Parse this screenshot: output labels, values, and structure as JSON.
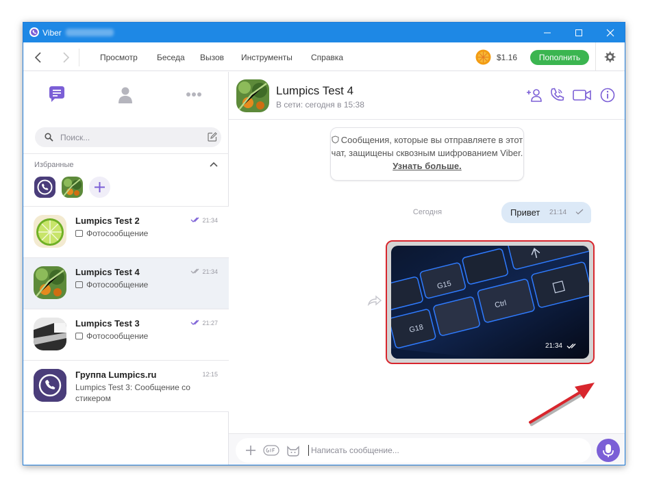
{
  "window": {
    "title": "Viber"
  },
  "menu": {
    "items": [
      "Просмотр",
      "Беседа",
      "Вызов",
      "Инструменты",
      "Справка"
    ],
    "balance": "$1.16",
    "topup_label": "Пополнить"
  },
  "sidebar": {
    "search_placeholder": "Поиск...",
    "favorites_label": "Избранные",
    "chats": [
      {
        "name": "Lumpics Test 2",
        "time": "21:34",
        "preview": "Фотосообщение",
        "read": true
      },
      {
        "name": "Lumpics Test 4",
        "time": "21:34",
        "preview": "Фотосообщение",
        "read": false
      },
      {
        "name": "Lumpics Test 3",
        "time": "21:27",
        "preview": "Фотосообщение",
        "read": true
      },
      {
        "name": "Группа Lumpics.ru",
        "time": "12:15",
        "preview": "Lumpics Test 3: Сообщение со стикером"
      }
    ]
  },
  "chat": {
    "name": "Lumpics Test 4",
    "status": "В сети: сегодня в 15:38",
    "encryption_notice": "Сообщения, которые вы отправляете в этот чат, защищены сквозным шифрованием Viber.",
    "encryption_link": "Узнать больше.",
    "date_divider": "Сегодня",
    "messages": [
      {
        "text": "Привет",
        "time": "21:14"
      },
      {
        "type": "photo",
        "time": "21:34"
      }
    ],
    "photo_keys": [
      "G15",
      "G18",
      "Ctrl"
    ],
    "input_placeholder": "Написать сообщение..."
  },
  "colors": {
    "accent": "#7b5fd6",
    "titlebar": "#1e88e5",
    "topup": "#3bb550",
    "highlight": "#d8262d"
  }
}
